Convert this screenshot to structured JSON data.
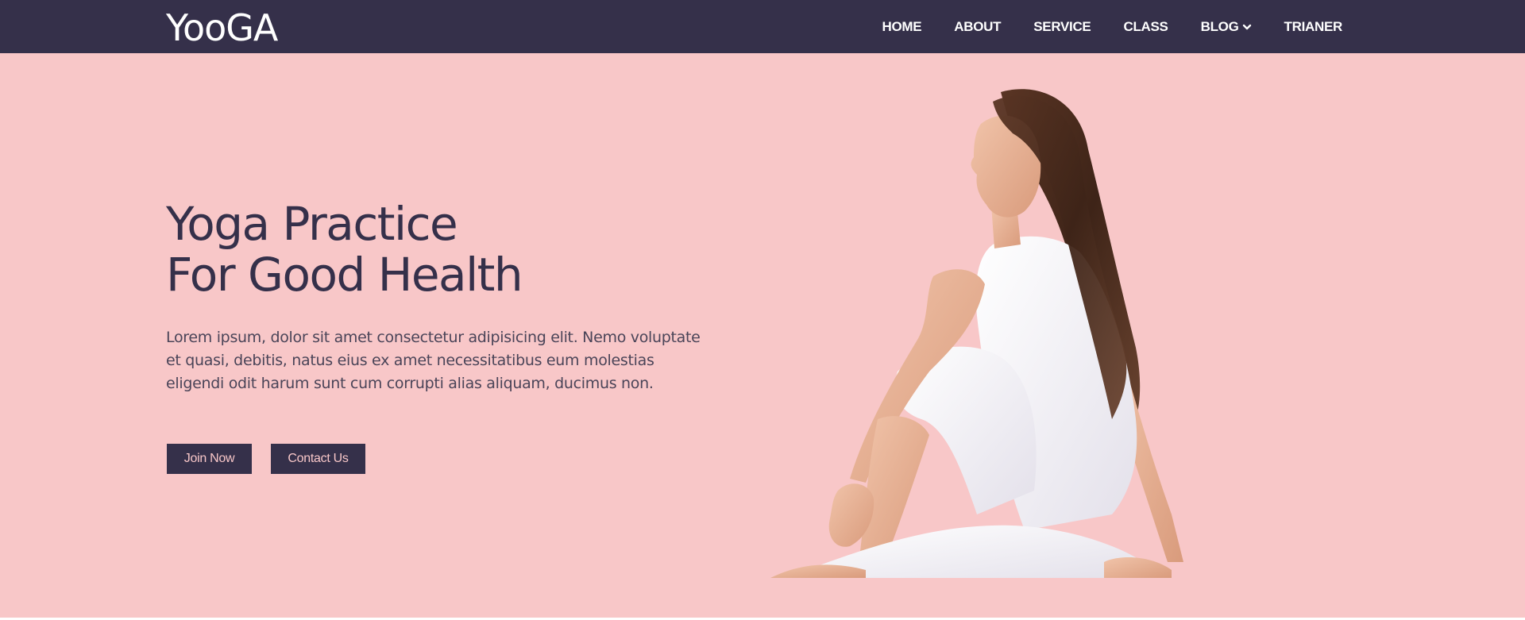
{
  "header": {
    "logo": "YooGA",
    "nav": [
      {
        "label": "HOME"
      },
      {
        "label": "ABOUT"
      },
      {
        "label": "SERVICE"
      },
      {
        "label": "CLASS"
      },
      {
        "label": "BLOG",
        "has_dropdown": true
      },
      {
        "label": "TRIANER"
      }
    ]
  },
  "hero": {
    "title_line1": "Yoga Practice",
    "title_line2": "For Good Health",
    "description": "Lorem ipsum, dolor sit amet consectetur adipisicing elit. Nemo voluptate et quasi, debitis, natus eius ex amet necessitatibus eum molestias eligendi odit harum sunt cum corrupti alias aliquam, ducimus non.",
    "join_label": "Join Now",
    "contact_label": "Contact Us"
  },
  "colors": {
    "navbar": "#35304a",
    "background": "#f8c7c8",
    "button": "#35304a",
    "button_text": "#f8c7c8"
  },
  "icons": {
    "blog_dropdown": "chevron-down-icon"
  }
}
